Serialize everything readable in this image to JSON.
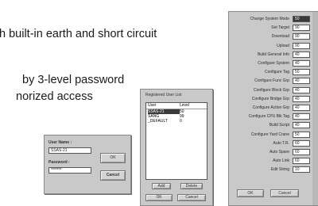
{
  "doc": {
    "line1": "h built-in earth and short circuit",
    "line2": "by 3-level password",
    "line3": "norized access"
  },
  "login": {
    "user_label": "User Name :",
    "user_value": "SSAS-21",
    "password_label": "Password :",
    "password_value": "*******",
    "ok_label": "OK",
    "cancel_label": "Cancel"
  },
  "userlist": {
    "title": "Registered User List",
    "col_user": "User",
    "col_level": "Level",
    "users": [
      {
        "name": "SSAS-21",
        "level": "50"
      },
      {
        "name": "SANG",
        "level": "99"
      },
      {
        "name": "_DEFAULT",
        "level": "0"
      }
    ],
    "add_label": "Add",
    "delete_label": "Delete",
    "ok_label": "OK",
    "cancel_label": "Cancel"
  },
  "settings": {
    "rows": [
      {
        "label": "Change System Mode",
        "value": "50"
      },
      {
        "label": "Set Target",
        "value": "90"
      },
      {
        "label": "Download",
        "value": "90"
      },
      {
        "label": "Upload",
        "value": "90"
      },
      {
        "label": "Build General Info",
        "value": "40"
      },
      {
        "label": "Configure System",
        "value": "40"
      },
      {
        "label": "Configure Tag",
        "value": "50"
      },
      {
        "label": "Configure Func Grp",
        "value": "40"
      },
      {
        "label": "Configure Block Grp",
        "value": "40"
      },
      {
        "label": "Configure Bridge Grp",
        "value": "40"
      },
      {
        "label": "Configure Action Grp",
        "value": "40"
      },
      {
        "label": "Configure CPU Blk Tag",
        "value": "40"
      },
      {
        "label": "Build Script",
        "value": "40"
      },
      {
        "label": "Configure Yard Crane",
        "value": "50"
      },
      {
        "label": "Auto T.R.",
        "value": "60"
      },
      {
        "label": "Auto Spare",
        "value": "60"
      },
      {
        "label": "Auto Link",
        "value": "60"
      },
      {
        "label": "Edit String",
        "value": "10"
      }
    ],
    "ok_label": "OK",
    "cancel_label": "Cancel"
  }
}
